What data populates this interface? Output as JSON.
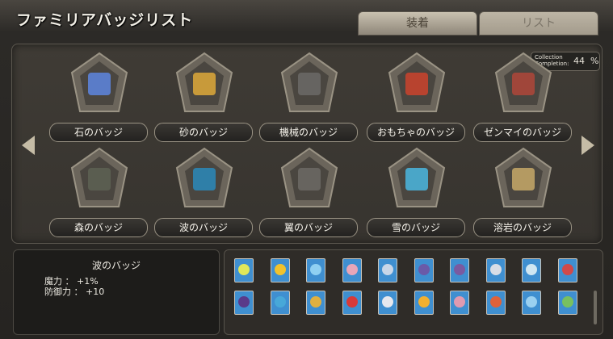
{
  "window": {
    "title": "ファミリアバッジリスト",
    "tabs": {
      "equip": "装着",
      "list": "リスト"
    }
  },
  "collection": {
    "label_line1": "Collection",
    "label_line2": "Completion:",
    "value": "44",
    "unit": "%"
  },
  "badges": [
    {
      "label": "石のバッジ",
      "icon": "crystal-icon",
      "locked": false,
      "color": "#5a7cc8"
    },
    {
      "label": "砂のバッジ",
      "icon": "pot-icon",
      "locked": false,
      "color": "#c89a3a"
    },
    {
      "label": "機械のバッジ",
      "icon": "gear-icon",
      "locked": true,
      "color": "#8a8a8a"
    },
    {
      "label": "おもちゃのバッジ",
      "icon": "toy-castle-icon",
      "locked": false,
      "color": "#b8432f"
    },
    {
      "label": "ゼンマイのバッジ",
      "icon": "clockwork-icon",
      "locked": false,
      "color": "#a0463a"
    },
    {
      "label": "森のバッジ",
      "icon": "forest-icon",
      "locked": true,
      "color": "#6f7a64"
    },
    {
      "label": "波のバッジ",
      "icon": "wave-orb-icon",
      "locked": false,
      "color": "#2f7fa8"
    },
    {
      "label": "翼のバッジ",
      "icon": "wing-icon",
      "locked": true,
      "color": "#8c8a86"
    },
    {
      "label": "雪のバッジ",
      "icon": "snowflake-icon",
      "locked": false,
      "color": "#4aa6c8"
    },
    {
      "label": "溶岩のバッジ",
      "icon": "lava-ruins-icon",
      "locked": false,
      "color": "#b49a62"
    }
  ],
  "selected": {
    "name": "波のバッジ",
    "stats": [
      {
        "label": "魔力 ：",
        "value": "+1%"
      },
      {
        "label": "防御力 ：",
        "value": "+10"
      }
    ]
  },
  "famiglia_cards": [
    {
      "bg": "#3f8fd0",
      "fg": "#e0e85a"
    },
    {
      "bg": "#3f8fd0",
      "fg": "#f2c22c"
    },
    {
      "bg": "#3f8fd0",
      "fg": "#8fd0f2"
    },
    {
      "bg": "#3f8fd0",
      "fg": "#e8a6b8"
    },
    {
      "bg": "#3f8fd0",
      "fg": "#c8d6e8"
    },
    {
      "bg": "#3f8fd0",
      "fg": "#6a5aa8"
    },
    {
      "bg": "#3f8fd0",
      "fg": "#7a5aa0"
    },
    {
      "bg": "#3f8fd0",
      "fg": "#d8dde6"
    },
    {
      "bg": "#3f8fd0",
      "fg": "#cfe6f2"
    },
    {
      "bg": "#3f8fd0",
      "fg": "#d04a4a"
    },
    {
      "bg": "#3f8fd0",
      "fg": "#5a3a8a"
    },
    {
      "bg": "#3f8fd0",
      "fg": "#48a8d8"
    },
    {
      "bg": "#3f8fd0",
      "fg": "#e0b040"
    },
    {
      "bg": "#3f8fd0",
      "fg": "#d83a3a"
    },
    {
      "bg": "#3f8fd0",
      "fg": "#e6e8ee"
    },
    {
      "bg": "#3f8fd0",
      "fg": "#f2b030"
    },
    {
      "bg": "#3f8fd0",
      "fg": "#e09ab0"
    },
    {
      "bg": "#3f8fd0",
      "fg": "#e0623a"
    },
    {
      "bg": "#3f8fd0",
      "fg": "#9ad0f0"
    },
    {
      "bg": "#3f8fd0",
      "fg": "#78c060"
    }
  ]
}
